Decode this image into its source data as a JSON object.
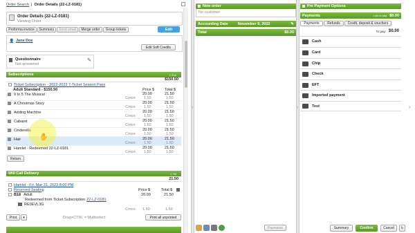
{
  "breadcrumb": {
    "search": "Order Search",
    "sep": "|",
    "current": "Order Details (22-LZ-0181)"
  },
  "order": {
    "title": "Order Details (22-LZ-0181)",
    "subtitle": "Viewing Order",
    "edit": "Edit"
  },
  "tabs": [
    "Proforma invoice",
    "Summary",
    "Send email",
    "Merge order",
    "Group tickets"
  ],
  "customer": {
    "name": "Jane Doe",
    "edit_soft_credits": "Edit Soft Credits"
  },
  "questionnaire": {
    "title": "Questionnaire",
    "status": "Not answered"
  },
  "subscriptions": {
    "header": "Subscriptions",
    "count": "1 Sub",
    "total": "$150.50",
    "package_link": "Ticket Subscription - 2022-2023 7-Ticket Season Pass",
    "package_line": "Adult Standard - $150.50",
    "col_price": "Price $",
    "col_total": "Total $",
    "items": [
      {
        "name": "9 to 5 The Musical",
        "code": "Cmon",
        "price": "20.00",
        "fee": "1.50",
        "total": "21.50",
        "total2": "1.50"
      },
      {
        "name": "A Christmas Story",
        "code": "Cmon",
        "price": "20.00",
        "fee": "1.50",
        "total": "21.50",
        "total2": "1.50"
      },
      {
        "name": "Adding Machine",
        "code": "Cmon",
        "price": "20.00",
        "fee": "1.50",
        "total": "21.50",
        "total2": "1.50"
      },
      {
        "name": "Cabaret",
        "code": "Cmon",
        "price": "20.00",
        "fee": "1.50",
        "total": "21.50",
        "total2": "1.50"
      },
      {
        "name": "Cinderella",
        "code": "Cmon",
        "price": "20.00",
        "fee": "1.50",
        "total": "21.50",
        "total2": "1.50"
      },
      {
        "name": "Hair",
        "code": "Cmon",
        "price": "20.00",
        "fee": "1.50",
        "total": "21.50",
        "total2": "1.50"
      },
      {
        "name": "Hamlet - Redeemed 22-LZ-0181",
        "code": "Cmon",
        "price": "20.00",
        "fee": "1.50",
        "total": "21.50",
        "total2": "1.50"
      }
    ],
    "return": "Return"
  },
  "will_call": {
    "header": "Will Call Delivery",
    "count": "1 Tkt",
    "total": "21.50",
    "event_link": "Hamlet - Fri, Mar 31, 2023 8:00 PM",
    "reserved": "Reserved Seating",
    "col_price": "Price $",
    "col_total": "Total $",
    "seat": "B18",
    "ticket_type": "Adult",
    "redeemed_text": "Redeemed from Ticket Subscription",
    "redeemed_link": "22-LZ-0181",
    "barcode": "RE0EVL3G",
    "code": "Cmon",
    "price": "20.00",
    "fee": "1.50",
    "total2": "1.50",
    "print": "Print",
    "drag_hint": "Drag+CTRL = Multiselect",
    "print_all": "Print all unprinted"
  },
  "new_order": {
    "header": "New order",
    "customer": "No customer"
  },
  "accounting": {
    "label": "Accounting Date",
    "date": "November 9, 2022"
  },
  "totals": {
    "label": "Total",
    "value": "$0.00"
  },
  "pre_payment": {
    "header": "Pre Payment Options"
  },
  "payments": {
    "header": "Payments",
    "left_to_pay_label": "Lots to pay",
    "left_to_pay_value": "$0.00",
    "tabs": [
      "Payments",
      "Refunds",
      "Credit, deposit & vouchers"
    ],
    "to_pay_label": "To pay:",
    "to_pay_value": "$0.00",
    "methods": [
      "Cash",
      "Card",
      "Chip",
      "Check",
      "EFT",
      "Imported payment",
      "Test"
    ]
  },
  "footer": {
    "payments_btn": "Payments",
    "summary": "Summary",
    "confirm": "Confirm",
    "cancel": "Cancel"
  },
  "colors": {
    "green": "#6aac30",
    "link": "#1a4f9c",
    "highlight": "#dce9f7",
    "cursor": "#f3f34a"
  }
}
